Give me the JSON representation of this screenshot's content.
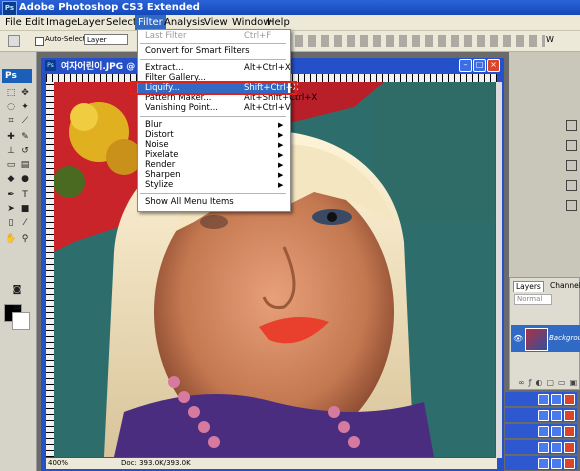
{
  "app": {
    "title": "Adobe Photoshop CS3 Extended",
    "logo": "Ps"
  },
  "menubar": {
    "items": [
      "File",
      "Edit",
      "Image",
      "Layer",
      "Select",
      "Filter",
      "Analysis",
      "View",
      "Window",
      "Help"
    ],
    "active": "Filter"
  },
  "options": {
    "auto_select_label": "Auto-Select:",
    "auto_select_value": "Layer",
    "workspace_label": "W"
  },
  "toolbox": {
    "badge": "Ps"
  },
  "document": {
    "title": "여자어린이.JPG @",
    "zoom": "400%",
    "doc_info": "Doc: 393.0K/393.0K"
  },
  "filter_menu": {
    "items": [
      {
        "label": "Last Filter",
        "shortcut": "Ctrl+F",
        "state": "disabled"
      },
      {
        "separator": true
      },
      {
        "label": "Convert for Smart Filters",
        "shortcut": ""
      },
      {
        "separator": true
      },
      {
        "label": "Extract...",
        "shortcut": "Alt+Ctrl+X"
      },
      {
        "label": "Filter Gallery...",
        "shortcut": ""
      },
      {
        "label": "Liquify...",
        "shortcut": "Shift+Ctrl+X",
        "state": "highlighted"
      },
      {
        "label": "Pattern Maker...",
        "shortcut": "Alt+Shift+Ctrl+X"
      },
      {
        "label": "Vanishing Point...",
        "shortcut": "Alt+Ctrl+V"
      },
      {
        "separator": true
      },
      {
        "label": "Blur",
        "submenu": true
      },
      {
        "label": "Distort",
        "submenu": true
      },
      {
        "label": "Noise",
        "submenu": true
      },
      {
        "label": "Pixelate",
        "submenu": true
      },
      {
        "label": "Render",
        "submenu": true
      },
      {
        "label": "Sharpen",
        "submenu": true
      },
      {
        "label": "Stylize",
        "submenu": true
      },
      {
        "separator": true
      },
      {
        "label": "Show All Menu Items",
        "shortcut": ""
      }
    ]
  },
  "layers_panel": {
    "tabs": [
      "Layers",
      "Channels"
    ],
    "blend_mode": "Normal",
    "layer_name": "Background"
  },
  "colors": {
    "title_bar": "#1f55c8",
    "menu_highlight": "#316ac5",
    "callout_box": "#e0201a"
  }
}
